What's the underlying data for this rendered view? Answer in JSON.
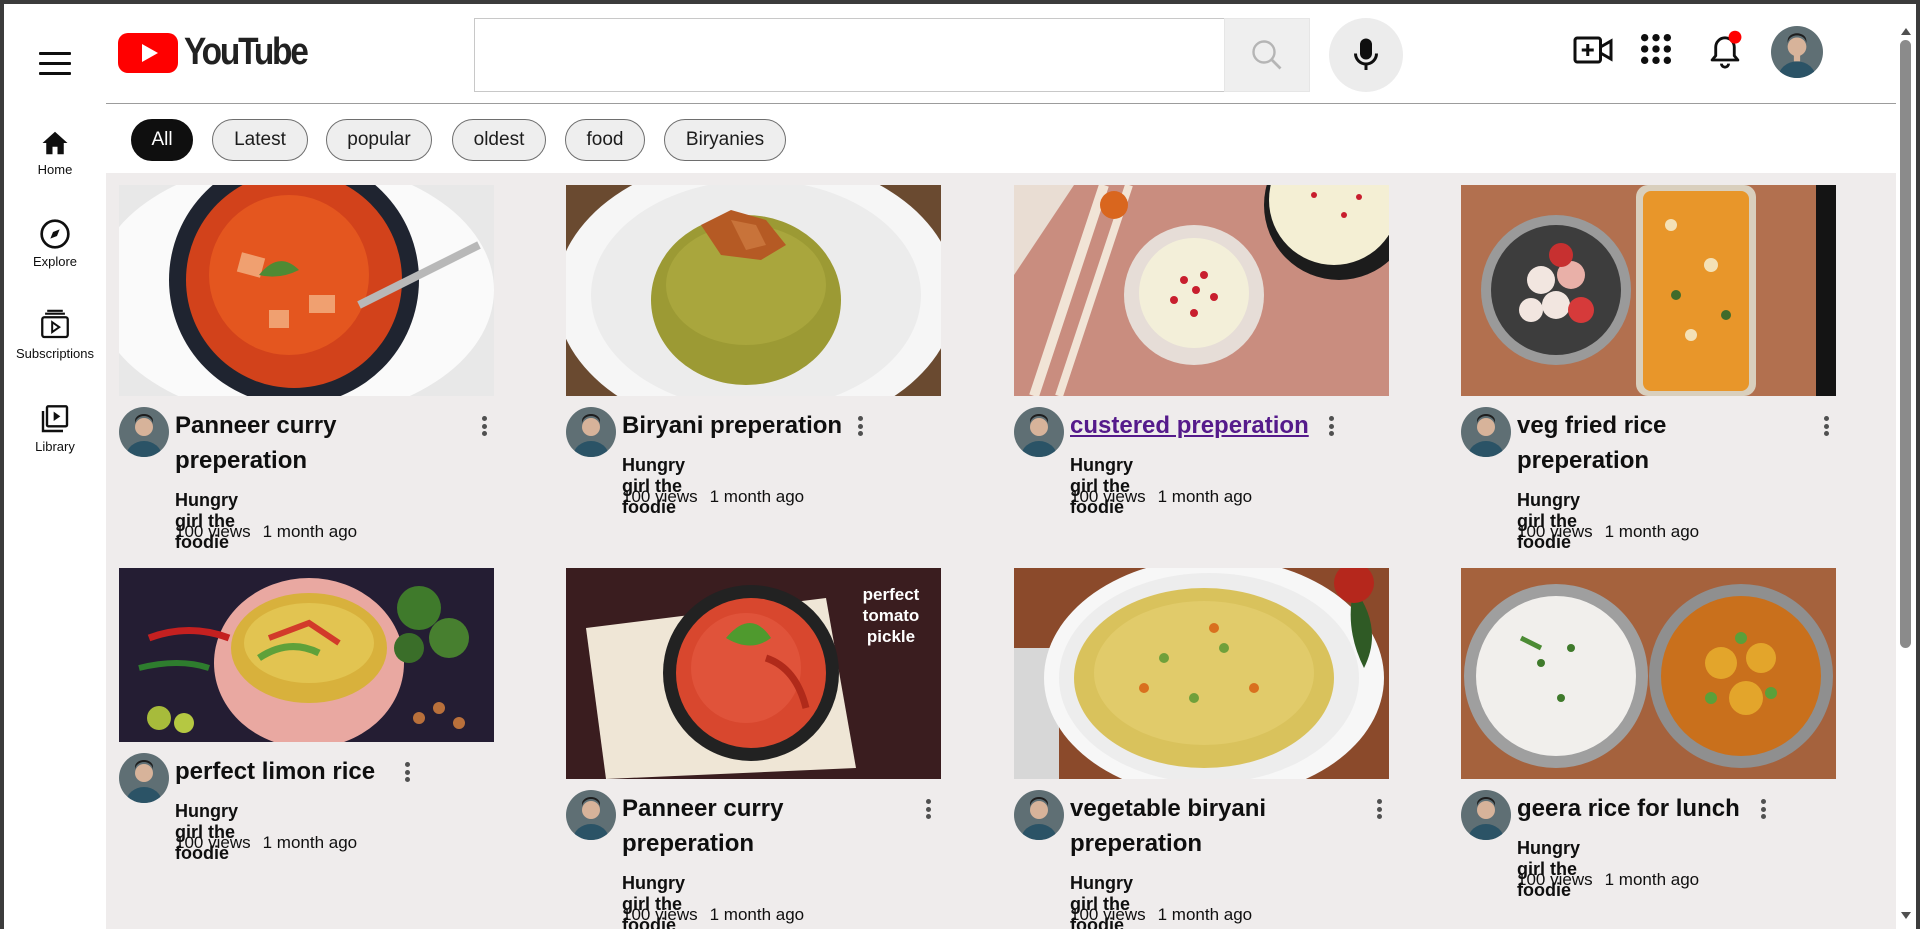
{
  "app": {
    "brand": "YouTube",
    "brand_color": "#ff0000"
  },
  "sidebar": {
    "items": [
      {
        "label": "Home",
        "icon": "home-icon"
      },
      {
        "label": "Explore",
        "icon": "compass-icon"
      },
      {
        "label": "Subscriptions",
        "icon": "subscriptions-icon"
      },
      {
        "label": "Library",
        "icon": "library-icon"
      }
    ]
  },
  "header": {
    "search": {
      "value": "",
      "placeholder": ""
    },
    "icons": [
      "search-icon",
      "mic-icon",
      "create-video-icon",
      "apps-grid-icon",
      "notifications-bell-icon",
      "account-avatar"
    ],
    "notification_dot_color": "#ff0000"
  },
  "chips": [
    "All",
    "Latest",
    "popular",
    "oldest",
    "food",
    "Biryanies"
  ],
  "active_chip": "All",
  "videos": [
    {
      "title": "Panneer curry preperation",
      "channel": "Hungry girl the foodie",
      "views": "100 views",
      "age": "1 month ago"
    },
    {
      "title": "Biryani preperation",
      "channel": "Hungry girl the foodie",
      "views": "100 views",
      "age": "1 month ago"
    },
    {
      "title": "custered preperation",
      "channel": "Hungry girl the foodie",
      "views": "100 views",
      "age": "1 month ago",
      "visited": true
    },
    {
      "title": "veg fried rice preperation",
      "channel": "Hungry girl the foodie",
      "views": "100 views",
      "age": "1 month ago"
    },
    {
      "title": "perfect limon rice",
      "channel": "Hungry girl the foodie",
      "views": "100 views",
      "age": "1 month ago"
    },
    {
      "title": "Panneer curry preperation",
      "channel": "Hungry girl the foodie",
      "views": "100 views",
      "age": "1 month ago",
      "thumb_overlay": "perfect tomato pickle"
    },
    {
      "title": "vegetable biryani preperation",
      "channel": "Hungry girl the foodie",
      "views": "100 views",
      "age": "1 month ago"
    },
    {
      "title": "geera rice for lunch",
      "channel": "Hungry girl the foodie",
      "views": "100 views",
      "age": "1 month ago"
    }
  ]
}
